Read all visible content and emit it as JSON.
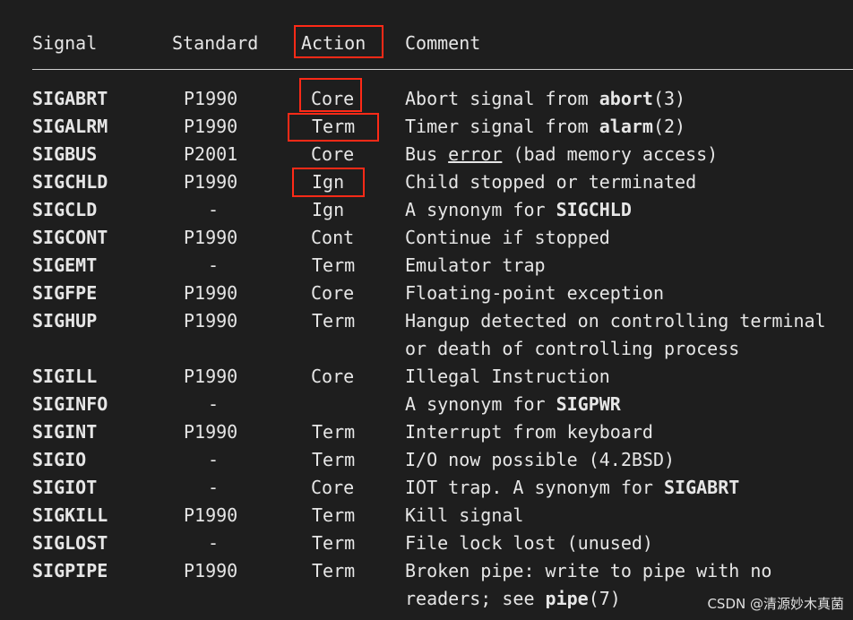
{
  "header": {
    "signal": "Signal",
    "standard": "Standard",
    "action": "Action",
    "comment": "Comment"
  },
  "rows": [
    {
      "signal": "SIGABRT",
      "standard": "P1990",
      "action": "Core",
      "comment": [
        "Abort signal from ",
        {
          "b": "abort"
        },
        "(3)"
      ]
    },
    {
      "signal": "SIGALRM",
      "standard": "P1990",
      "action": "Term",
      "comment": [
        "Timer signal from ",
        {
          "b": "alarm"
        },
        "(2)"
      ]
    },
    {
      "signal": "SIGBUS",
      "standard": "P2001",
      "action": "Core",
      "comment": [
        "Bus ",
        {
          "u": "error"
        },
        " (bad memory access)"
      ]
    },
    {
      "signal": "SIGCHLD",
      "standard": "P1990",
      "action": "Ign",
      "comment": [
        "Child stopped or terminated"
      ]
    },
    {
      "signal": "SIGCLD",
      "standard": "-",
      "action": "Ign",
      "comment": [
        "A synonym for ",
        {
          "b": "SIGCHLD"
        }
      ]
    },
    {
      "signal": "SIGCONT",
      "standard": "P1990",
      "action": "Cont",
      "comment": [
        "Continue if stopped"
      ]
    },
    {
      "signal": "SIGEMT",
      "standard": "-",
      "action": "Term",
      "comment": [
        "Emulator trap"
      ]
    },
    {
      "signal": "SIGFPE",
      "standard": "P1990",
      "action": "Core",
      "comment": [
        "Floating-point exception"
      ]
    },
    {
      "signal": "SIGHUP",
      "standard": "P1990",
      "action": "Term",
      "comment": [
        "Hangup detected on controlling terminal"
      ]
    },
    {
      "signal": "",
      "standard": "",
      "action": "",
      "comment": [
        "or death of controlling process"
      ]
    },
    {
      "signal": "SIGILL",
      "standard": "P1990",
      "action": "Core",
      "comment": [
        "Illegal Instruction"
      ]
    },
    {
      "signal": "SIGINFO",
      "standard": "-",
      "action": "",
      "comment": [
        "A synonym for ",
        {
          "b": "SIGPWR"
        }
      ]
    },
    {
      "signal": "SIGINT",
      "standard": "P1990",
      "action": "Term",
      "comment": [
        "Interrupt from keyboard"
      ]
    },
    {
      "signal": "SIGIO",
      "standard": "-",
      "action": "Term",
      "comment": [
        "I/O now possible (4.2BSD)"
      ]
    },
    {
      "signal": "SIGIOT",
      "standard": "-",
      "action": "Core",
      "comment": [
        "IOT trap. A synonym for ",
        {
          "b": "SIGABRT"
        }
      ]
    },
    {
      "signal": "SIGKILL",
      "standard": "P1990",
      "action": "Term",
      "comment": [
        "Kill signal"
      ]
    },
    {
      "signal": "SIGLOST",
      "standard": "-",
      "action": "Term",
      "comment": [
        "File lock lost (unused)"
      ]
    },
    {
      "signal": "SIGPIPE",
      "standard": "P1990",
      "action": "Term",
      "comment": [
        "Broken pipe: write to pipe with no"
      ]
    },
    {
      "signal": "",
      "standard": "",
      "action": "",
      "comment": [
        "readers; see ",
        {
          "b": "pipe"
        },
        "(7)"
      ]
    }
  ],
  "watermark": "CSDN @清源妙木真菌",
  "colors": {
    "background": "#1e1e1e",
    "text": "#e6e6e6",
    "highlight_box": "#ff2a17"
  }
}
